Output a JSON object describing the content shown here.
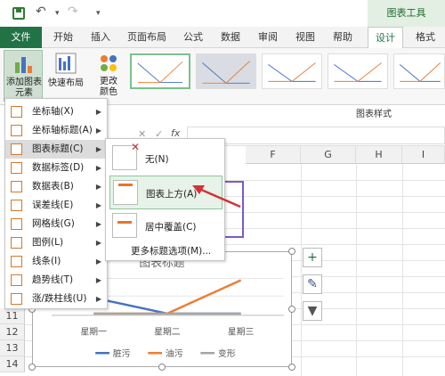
{
  "ribbon_context": "图表工具",
  "tabs": [
    "文件",
    "开始",
    "插入",
    "页面布局",
    "公式",
    "数据",
    "审阅",
    "视图",
    "帮助",
    "设计",
    "格式"
  ],
  "ribbon": {
    "add_chart_element": "添加图表\n元素",
    "quick_layout": "快速布局",
    "change_colors": "更改\n颜色",
    "styles_group": "图表样式"
  },
  "colors": {
    "brand": "#217346",
    "accent": "#e8742c",
    "series1": "#4472c4",
    "series2": "#ed7d31",
    "series3": "#a5a5a5"
  },
  "menu": {
    "items": [
      {
        "label": "坐标轴(X)",
        "icon": "axis-icon"
      },
      {
        "label": "坐标轴标题(A)",
        "icon": "axis-title-icon"
      },
      {
        "label": "图表标题(C)",
        "icon": "chart-title-icon"
      },
      {
        "label": "数据标签(D)",
        "icon": "data-labels-icon"
      },
      {
        "label": "数据表(B)",
        "icon": "data-table-icon"
      },
      {
        "label": "误差线(E)",
        "icon": "error-bars-icon"
      },
      {
        "label": "网格线(G)",
        "icon": "gridlines-icon"
      },
      {
        "label": "图例(L)",
        "icon": "legend-icon"
      },
      {
        "label": "线条(I)",
        "icon": "lines-icon"
      },
      {
        "label": "趋势线(T)",
        "icon": "trendline-icon"
      },
      {
        "label": "涨/跌柱线(U)",
        "icon": "updown-bars-icon"
      }
    ]
  },
  "submenu": {
    "none": "无(N)",
    "above": "图表上方(A)",
    "centered": "居中覆盖(C)",
    "more": "更多标题选项(M)..."
  },
  "formula_fx": "fx",
  "columns": [
    "F",
    "G",
    "H",
    "I"
  ],
  "rows": [
    "11",
    "12",
    "13",
    "14"
  ],
  "chart_data": {
    "type": "line",
    "title": "图表标题",
    "categories": [
      "星期一",
      "星期二",
      "星期三"
    ],
    "series": [
      {
        "name": "脏污",
        "values": [
          10,
          1,
          1
        ]
      },
      {
        "name": "油污",
        "values": [
          1,
          1,
          20
        ]
      },
      {
        "name": "变形",
        "values": [
          1,
          1,
          1
        ]
      }
    ],
    "legend": "bottom"
  }
}
